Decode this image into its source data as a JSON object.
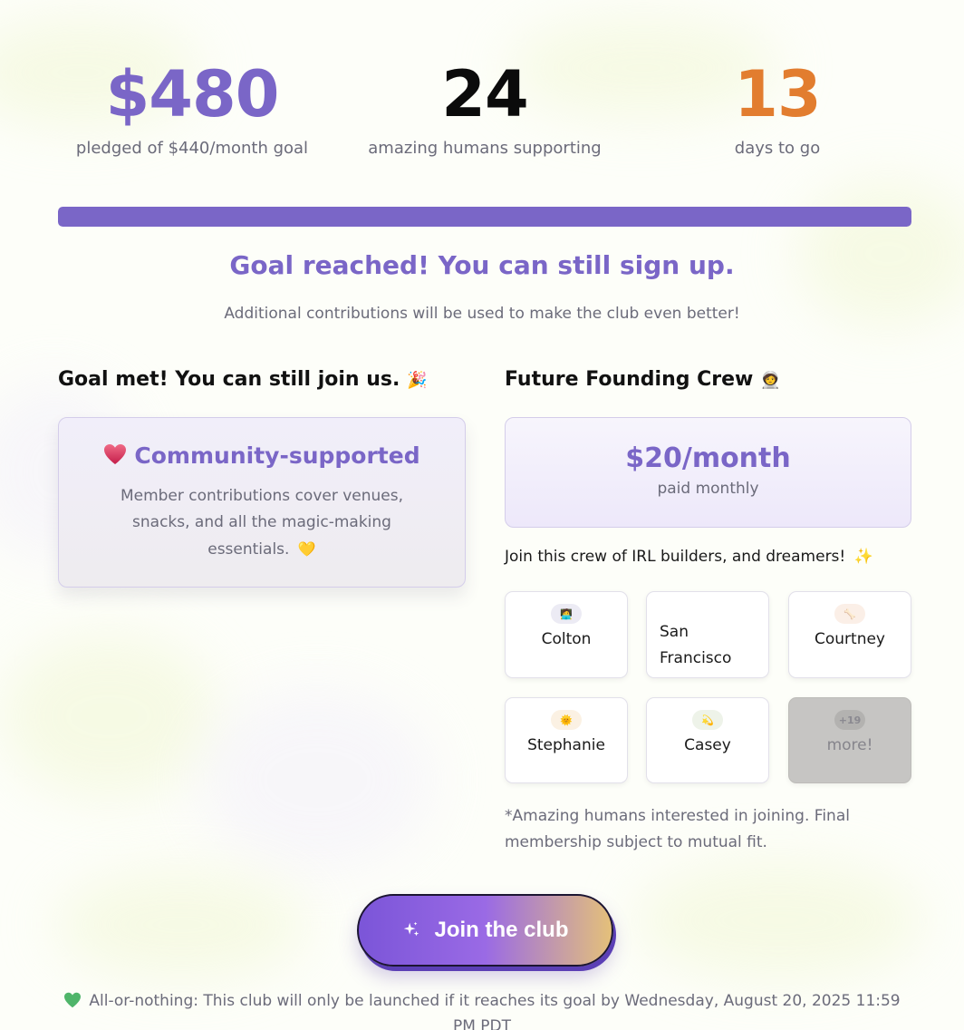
{
  "stats": [
    {
      "value": "$480",
      "label": "pledged of $440/month goal",
      "color": "#7a66c7"
    },
    {
      "value": "24",
      "label": "amazing humans supporting",
      "color": "#0b0b0b"
    },
    {
      "value": "13",
      "label": "days to go",
      "color": "#e27d2f"
    }
  ],
  "progress": {
    "fraction": 1.0
  },
  "goal": {
    "title": "Goal reached! You can still sign up.",
    "subtitle": "Additional contributions will be used to make the club even better!"
  },
  "left_column": {
    "title": "Goal met! You can still join us.",
    "title_emoji": "🎉",
    "card_heading": "Community-supported",
    "card_text": "Member contributions cover venues, snacks, and all the magic-making essentials.",
    "card_emoji": "💛"
  },
  "right_column": {
    "title": "Future Founding Crew",
    "title_emoji": "🧑‍🚀",
    "price": "$20/month",
    "billing": "paid monthly",
    "crew_text": "Join this crew of IRL builders, and dreamers!",
    "crew_emoji": "✨",
    "members": [
      {
        "name": "Colton",
        "icon": "person-icon",
        "badge_bg": "#ecebf4",
        "glyph": "🧑‍💻"
      },
      {
        "name": "San Francisco",
        "icon": "",
        "badge_bg": "",
        "glyph": ""
      },
      {
        "name": "Courtney",
        "icon": "bone-icon",
        "badge_bg": "#fbefe7",
        "glyph": "🦴"
      },
      {
        "name": "Stephanie",
        "icon": "sun-icon",
        "badge_bg": "#fbf1e3",
        "glyph": "🌞"
      },
      {
        "name": "Casey",
        "icon": "comet-icon",
        "badge_bg": "#eef3e9",
        "glyph": "💫"
      },
      {
        "name": "more!",
        "icon": "",
        "badge_bg": "",
        "glyph": "+19"
      }
    ],
    "footnote": "*Amazing humans interested in joining. Final membership subject to mutual fit."
  },
  "cta": {
    "label": "Join the club"
  },
  "all_or_nothing": {
    "text": "All-or-nothing: This club will only be launched if it reaches its goal by Wednesday, August 20, 2025 11:59 PM PDT"
  }
}
